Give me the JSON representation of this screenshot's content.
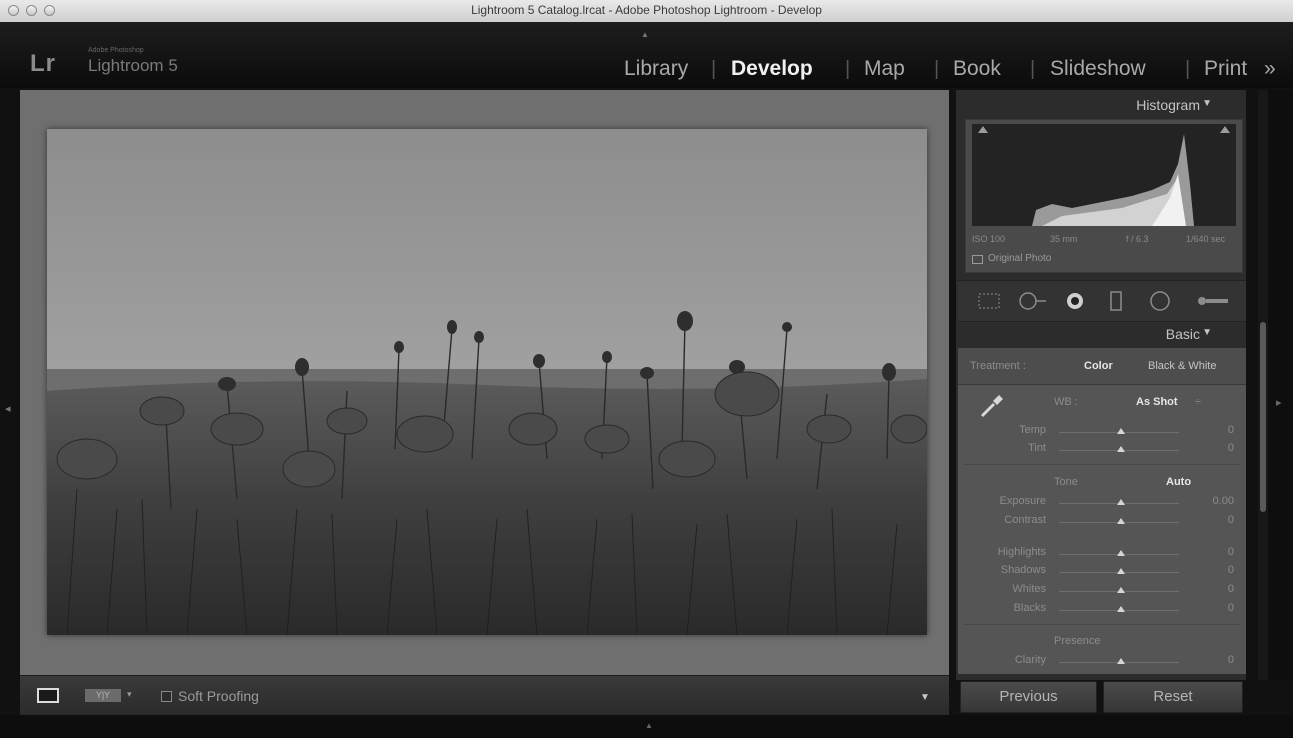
{
  "window": {
    "title": "Lightroom 5 Catalog.lrcat - Adobe Photoshop Lightroom - Develop"
  },
  "branding": {
    "logo": "Lr",
    "company": "Adobe Photoshop",
    "product": "Lightroom 5"
  },
  "modules": [
    {
      "label": "Library",
      "active": false
    },
    {
      "label": "Develop",
      "active": true
    },
    {
      "label": "Map",
      "active": false
    },
    {
      "label": "Book",
      "active": false
    },
    {
      "label": "Slideshow",
      "active": false
    },
    {
      "label": "Print",
      "active": false
    }
  ],
  "module_overflow": "»",
  "histogram": {
    "title": "Histogram",
    "exif": {
      "iso": "ISO 100",
      "focal": "35 mm",
      "aperture": "f / 6.3",
      "shutter": "1/640 sec"
    },
    "original_photo_label": "Original Photo"
  },
  "basic": {
    "title": "Basic",
    "treatment_label": "Treatment :",
    "treatment_color": "Color",
    "treatment_bw": "Black & White",
    "wb_label": "WB :",
    "wb_value": "As Shot",
    "temp_label": "Temp",
    "temp_value": "0",
    "tint_label": "Tint",
    "tint_value": "0",
    "tone_label": "Tone",
    "auto_label": "Auto",
    "exposure_label": "Exposure",
    "exposure_value": "0.00",
    "contrast_label": "Contrast",
    "contrast_value": "0",
    "highlights_label": "Highlights",
    "highlights_value": "0",
    "shadows_label": "Shadows",
    "shadows_value": "0",
    "whites_label": "Whites",
    "whites_value": "0",
    "blacks_label": "Blacks",
    "blacks_value": "0",
    "presence_label": "Presence",
    "clarity_label": "Clarity",
    "clarity_value": "0"
  },
  "toolbar": {
    "soft_proofing": "Soft Proofing",
    "compare": "Y|Y"
  },
  "buttons": {
    "previous": "Previous",
    "reset": "Reset"
  },
  "colors": {
    "active_module": "#f0f0f0",
    "inactive_module": "#a9a9a9",
    "panel_bg": "#555555"
  }
}
